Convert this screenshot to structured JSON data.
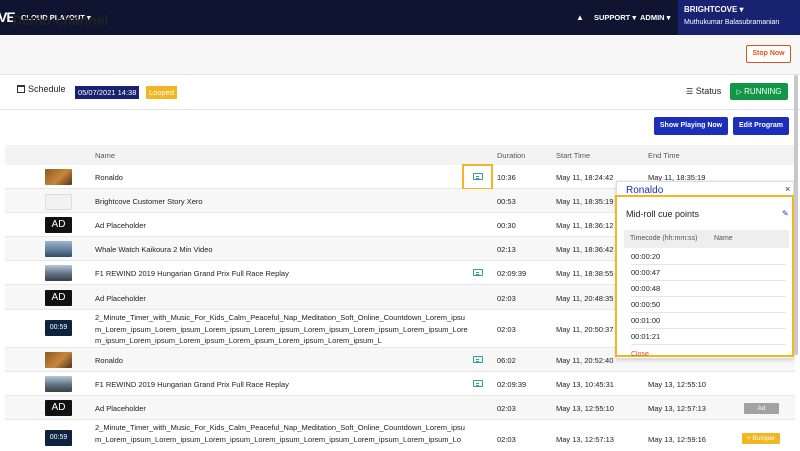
{
  "topbar": {
    "logo": "VE",
    "product": "CLOUD PLAYOUT ▾",
    "support": "SUPPORT ▾",
    "admin": "ADMIN ▾",
    "brand": "BRIGHTCOVE ▾",
    "user": "Muthukumar Balasubramanian"
  },
  "page": {
    "title": "Demo-channel",
    "stop_label": "Stop Now"
  },
  "schedule": {
    "label": "Schedule",
    "date": "05/07/2021 14:38",
    "looped": "Looped",
    "status_label": "Status",
    "running": "RUNNING"
  },
  "actions": {
    "show_playing": "Show Playing Now",
    "edit_program": "Edit Program"
  },
  "table": {
    "headers": {
      "name": "Name",
      "duration": "Duration",
      "start": "Start Time",
      "end": "End Time"
    },
    "rows": [
      {
        "name": "Ronaldo",
        "duration": "10:36",
        "start": "May 11, 18:24:42",
        "end": "May 11, 18:35:19"
      },
      {
        "name": "Brightcove Customer Story Xero",
        "duration": "00:53",
        "start": "May 11, 18:35:19",
        "end": ""
      },
      {
        "name": "Ad Placeholder",
        "duration": "00:30",
        "start": "May 11, 18:36:12",
        "end": "",
        "thumb": "AD"
      },
      {
        "name": "Whale Watch Kaikoura 2 Min Video",
        "duration": "02:13",
        "start": "May 11, 18:36:42",
        "end": ""
      },
      {
        "name": "F1 REWIND 2019 Hungarian Grand Prix Full Race Replay",
        "duration": "02:09:39",
        "start": "May 11, 18:38:55",
        "end": ""
      },
      {
        "name": "Ad Placeholder",
        "duration": "02:03",
        "start": "May 11, 20:48:35",
        "end": "",
        "thumb": "AD"
      },
      {
        "name": "2_Minute_Timer_with_Music_For_Kids_Calm_Peaceful_Nap_Meditation_Soft_Online_Countdown_Lorem_ipsum_Lorem_ipsum_Lorem_ipsum_Lorem_ipsum_Lorem_ipsum_Lorem_ipsum_Lorem_ipsum_Lorem_ipsum_Lorem_ipsum_Lorem_ipsum_Lorem_ipsum_Lorem_ipsum_Lorem_ipsum_Lorem_ipsum_L",
        "duration": "02:03",
        "start": "May 11, 20:50:37",
        "end": "",
        "thumb": "00:59"
      },
      {
        "name": "Ronaldo",
        "duration": "06:02",
        "start": "May 11, 20:52:40",
        "end": ""
      },
      {
        "name": "F1 REWIND 2019 Hungarian Grand Prix Full Race Replay",
        "duration": "02:09:39",
        "start": "May 13, 10:45:31",
        "end": "May 13, 12:55:10"
      },
      {
        "name": "Ad Placeholder",
        "duration": "02:03",
        "start": "May 13, 12:55:10",
        "end": "May 13, 12:57:13",
        "thumb": "AD",
        "tag": "Ad"
      },
      {
        "name": "2_Minute_Timer_with_Music_For_Kids_Calm_Peaceful_Nap_Meditation_Soft_Online_Countdown_Lorem_ipsum_Lorem_ipsum_Lorem_ipsum_Lorem_ipsum_Lorem_ipsum_Lorem_ipsum_Lorem_ipsum_Lorem_ipsum_Lo",
        "duration": "02:03",
        "start": "May 13, 12:57:13",
        "end": "May 13, 12:59:16",
        "thumb": "00:59",
        "tag": "+ Bumper"
      }
    ]
  },
  "popover": {
    "title": "Ronaldo",
    "close": "×",
    "heading": "Mid-roll cue points",
    "col_timecode": "Timecode (hh:mm:ss)",
    "col_name": "Name",
    "cues": [
      "00:00:20",
      "00:00:47",
      "00:00:48",
      "00:00:50",
      "00:01:00",
      "00:01:21"
    ],
    "close_link": "Close"
  },
  "colors": {
    "navy": "#0f1530",
    "brand_blue": "#172370",
    "action_blue": "#1b2fb8",
    "running_green": "#129648",
    "highlight": "#f3b623",
    "stop_orange": "#d9541e"
  }
}
